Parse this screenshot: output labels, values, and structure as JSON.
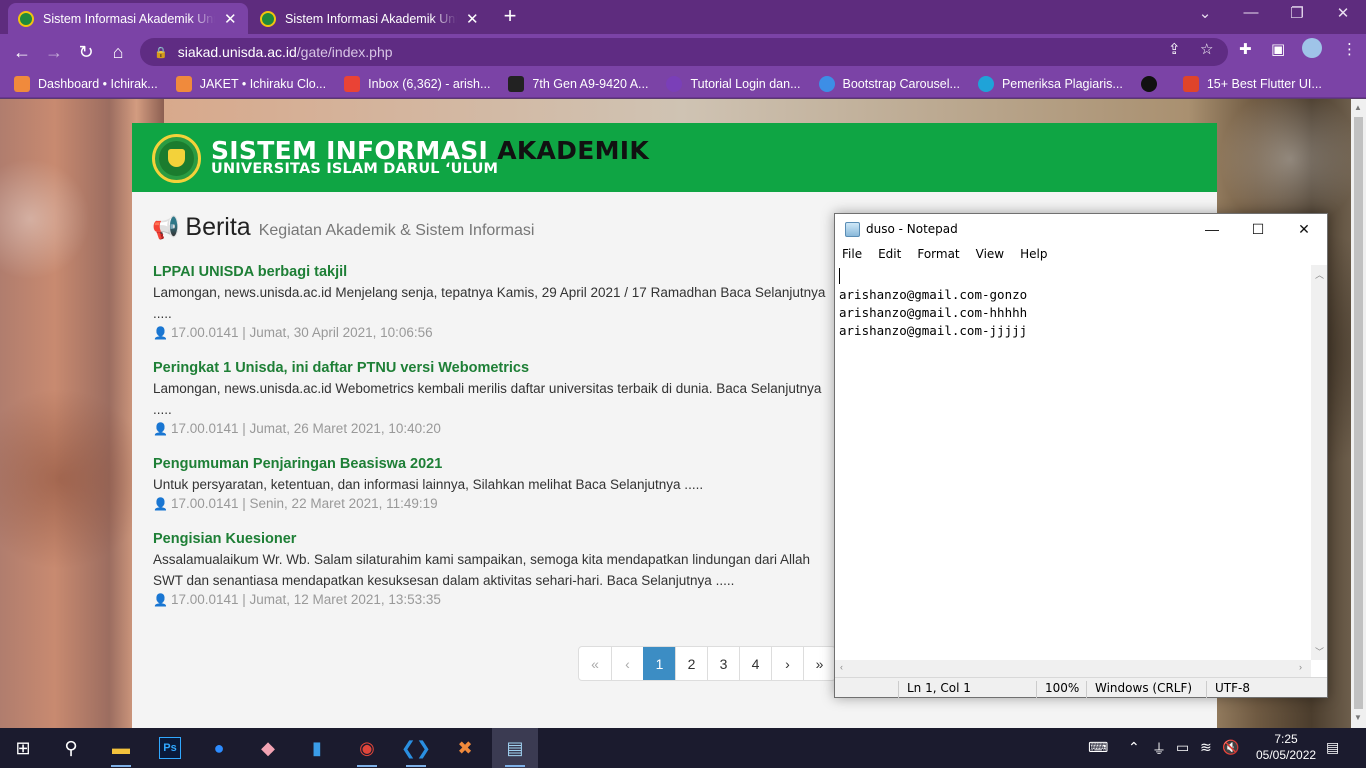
{
  "browser": {
    "tabs": [
      {
        "title": "Sistem Informasi Akademik Univ",
        "active": true
      },
      {
        "title": "Sistem Informasi Akademik Univ",
        "active": false
      }
    ],
    "new_tab_label": "+",
    "url_host": "siakad.unisda.ac.id",
    "url_path": "/gate/index.php",
    "bookmarks": [
      {
        "label": "Dashboard • Ichirak...",
        "color": "#f08a3c"
      },
      {
        "label": "JAKET • Ichiraku Clo...",
        "color": "#f08a3c"
      },
      {
        "label": "Inbox (6,362) - arish...",
        "color": "#ea4335"
      },
      {
        "label": "7th Gen A9-9420 A...",
        "color": "#222222"
      },
      {
        "label": "Tutorial Login dan...",
        "color": "#7a3fb8"
      },
      {
        "label": "Bootstrap Carousel...",
        "color": "#3d8ee6"
      },
      {
        "label": "Pemeriksa Plagiaris...",
        "color": "#1fa3d8"
      },
      {
        "label": "",
        "color": "#111111"
      },
      {
        "label": "15+ Best Flutter UI...",
        "color": "#e0442a"
      }
    ]
  },
  "site": {
    "brand_line1_a": "SISTEM INFORMASI",
    "brand_line1_b": "AKADEMIK",
    "brand_line2": "UNIVERSITAS ISLAM DARUL ‘ULUM",
    "heading": "Berita",
    "heading_sub": "Kegiatan Akademik & Sistem Informasi",
    "news": [
      {
        "title": "LPPAI UNISDA berbagi takjil",
        "desc": "Lamongan, news.unisda.ac.id  Menjelang senja, tepatnya Kamis, 29 April 2021 / 17 Ramadhan  Baca Selanjutnya",
        "desc2": ".....",
        "meta": "17.00.0141 | Jumat, 30 April 2021, 10:06:56"
      },
      {
        "title": "Peringkat 1 Unisda, ini daftar PTNU versi Webometrics",
        "desc": "Lamongan, news.unisda.ac.id Webometrics kembali merilis daftar universitas terbaik di dunia. Baca Selanjutnya",
        "desc2": ".....",
        "meta": "17.00.0141 | Jumat, 26 Maret 2021, 10:40:20"
      },
      {
        "title": "Pengumuman Penjaringan Beasiswa 2021",
        "desc": "Untuk persyaratan, ketentuan, dan informasi lainnya, Silahkan melihat Baca Selanjutnya .....",
        "desc2": "",
        "meta": "17.00.0141 | Senin, 22 Maret 2021, 11:49:19"
      },
      {
        "title": "Pengisian Kuesioner",
        "desc": "Assalamualaikum Wr. Wb. Salam silaturahim kami sampaikan, semoga kita mendapatkan lindungan dari Allah",
        "desc2": "SWT dan senantiasa mendapatkan kesuksesan dalam aktivitas sehari-hari. Baca Selanjutnya .....",
        "meta": "17.00.0141 | Jumat, 12 Maret 2021, 13:53:35"
      }
    ],
    "pagination": [
      "«",
      "‹",
      "1",
      "2",
      "3",
      "4",
      "›",
      "»"
    ],
    "current_page": "1"
  },
  "notepad": {
    "title": "duso - Notepad",
    "menu": [
      "File",
      "Edit",
      "Format",
      "View",
      "Help"
    ],
    "lines": [
      "",
      "arishanzo@gmail.com-gonzo",
      "arishanzo@gmail.com-hhhhh",
      "arishanzo@gmail.com-jjjjj"
    ],
    "status": {
      "position": "Ln 1, Col 1",
      "zoom": "100%",
      "eol": "Windows (CRLF)",
      "encoding": "UTF-8"
    }
  },
  "taskbar": {
    "time": "7:25",
    "date": "05/05/2022"
  },
  "colors": {
    "accent_green": "#0fa544",
    "browser_purple": "#7b43a6",
    "pager_active": "#3c8dc4"
  }
}
